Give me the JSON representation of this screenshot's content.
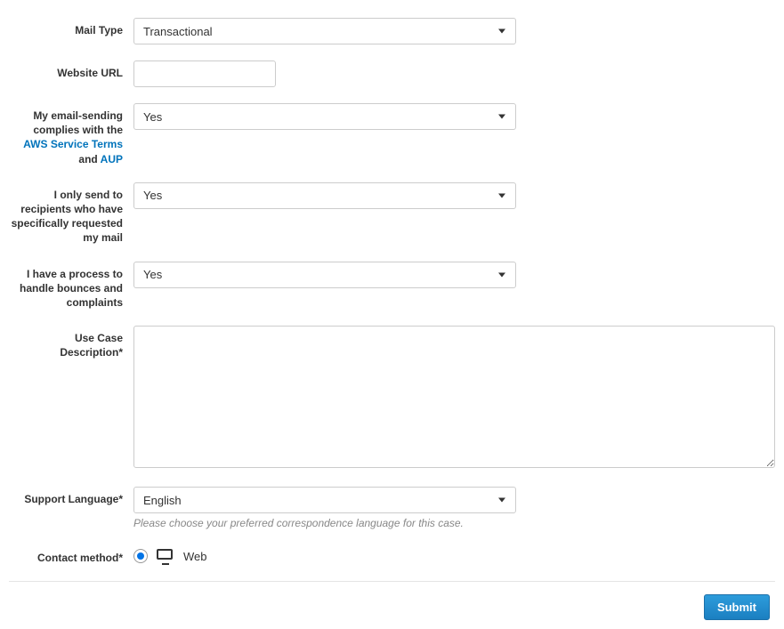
{
  "fields": {
    "mail_type": {
      "label": "Mail Type",
      "value": "Transactional"
    },
    "website_url": {
      "label": "Website URL",
      "value": ""
    },
    "compliance": {
      "label_pre": "My email-sending complies with the ",
      "link1": "AWS Service Terms",
      "mid": " and ",
      "link2": "AUP",
      "value": "Yes"
    },
    "recipients": {
      "label": "I only send to recipients who have specifically requested my mail",
      "value": "Yes"
    },
    "bounces": {
      "label": "I have a process to handle bounces and complaints",
      "value": "Yes"
    },
    "use_case": {
      "label": "Use Case Description*",
      "value": ""
    },
    "support_lang": {
      "label": "Support Language*",
      "value": "English",
      "help": "Please choose your preferred correspondence language for this case."
    },
    "contact": {
      "label": "Contact method*",
      "option_web": "Web"
    }
  },
  "actions": {
    "submit": "Submit"
  }
}
